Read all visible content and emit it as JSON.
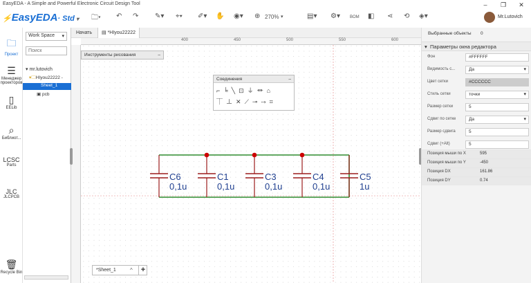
{
  "window": {
    "title": "EasyEDA - A Simple and Powerful Electronic Circuit Design Tool",
    "minimize": "–",
    "maximize": "❐",
    "close": "✕"
  },
  "toolbar": {
    "logo": "EasyEDA",
    "std": "· Std",
    "zoom": "270%",
    "bom": "BOM",
    "user": "Mr.Lutovich"
  },
  "leftbar": {
    "project": "Проект",
    "manager": "Менеджер проекторов",
    "eelib": "EELib",
    "library": "Библиот...",
    "parts": "Parts",
    "jlcpcb": "JLCPCB",
    "recycle": "Recycle Bin"
  },
  "panel": {
    "workspace": "Work Space",
    "search_placeholder": "Поиск",
    "user": "mr.lutovich",
    "project": "HIyou22222 -",
    "sheet": "Sheet_1",
    "pcb": "pcb"
  },
  "tabs": {
    "start": "Начать",
    "doc": "*HIyou22222"
  },
  "ruler": [
    "400",
    "450",
    "500",
    "550",
    "600"
  ],
  "drawing_tools": {
    "title": "Инструменты рисования"
  },
  "wiring": {
    "title": "Соединения"
  },
  "components": [
    {
      "ref": "C6",
      "val": "0,1u"
    },
    {
      "ref": "C1",
      "val": "0,1u"
    },
    {
      "ref": "C3",
      "val": "0,1u"
    },
    {
      "ref": "C4",
      "val": "0,1u"
    },
    {
      "ref": "C5",
      "val": "1u"
    }
  ],
  "sheet_tab": {
    "label": "*Sheet_1",
    "add": "+"
  },
  "right": {
    "selected": "Выбранные объекты",
    "selected_count": "0",
    "section": "Параметры окна редактора",
    "props": [
      {
        "label": "Фон",
        "value": "#FFFFFF",
        "dd": false
      },
      {
        "label": "Видимость с...",
        "value": "Да",
        "dd": true
      },
      {
        "label": "Цвет сетки",
        "value": "#CCCCCC",
        "dd": false
      },
      {
        "label": "Стиль сетки",
        "value": "точки",
        "dd": true
      },
      {
        "label": "Размер сетки",
        "value": "5",
        "dd": false
      },
      {
        "label": "Сдвиг по сетке",
        "value": "Да",
        "dd": true
      },
      {
        "label": "Размер сдвига",
        "value": "5",
        "dd": false
      },
      {
        "label": "Сдвиг (+Alt)",
        "value": "5",
        "dd": false
      }
    ],
    "positions": [
      {
        "label": "Позиция мыши по X",
        "value": "595"
      },
      {
        "label": "Позиция мыши по Y",
        "value": "-450"
      },
      {
        "label": "Позиция DX",
        "value": "161.86"
      },
      {
        "label": "Позиция DY",
        "value": "0.74"
      }
    ]
  },
  "colors": {
    "wire": "#2e8b2e",
    "part": "#9b1b1b",
    "junction": "#cc0000",
    "accent": "#1a6fd4"
  }
}
